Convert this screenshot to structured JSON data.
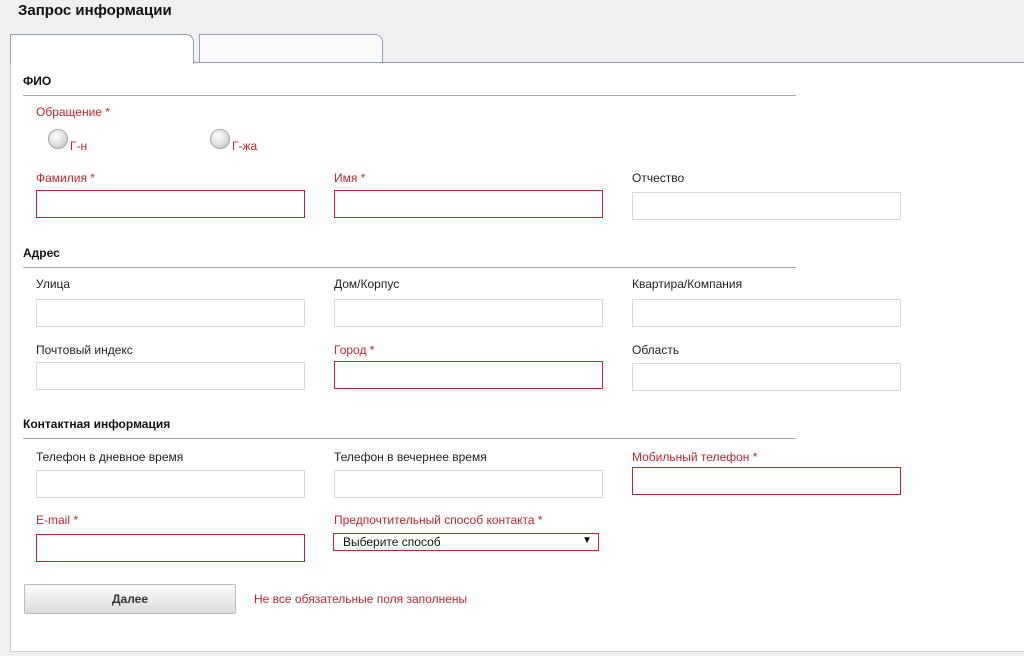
{
  "page_title": "Запрос информации",
  "sections": {
    "fio": "ФИО",
    "address": "Адрес",
    "contact": "Контактная информация"
  },
  "salutation": {
    "label": "Обращение *",
    "options": [
      "Г-н",
      "Г-жа"
    ]
  },
  "labels": {
    "last_name": "Фамилия *",
    "first_name": "Имя *",
    "patronymic": "Отчество",
    "street": "Улица",
    "house": "Дом/Корпус",
    "apartment": "Квартира/Компания",
    "postal_code": "Почтовый индекс",
    "city": "Город *",
    "region": "Область",
    "day_phone": "Телефон в дневное время",
    "evening_phone": "Телефон в вечернее время",
    "mobile_phone": "Мобильный телефон *",
    "email": "E-mail *",
    "contact_method": "Предпочтительный способ контакта *"
  },
  "contact_method_selected": "Выберите способ",
  "next_button": "Далее",
  "error_message": "Не все обязательные поля заполнены",
  "colors": {
    "required": "#c0262d",
    "border": "#d8d8d8",
    "tab_border": "#8f9fb8"
  }
}
